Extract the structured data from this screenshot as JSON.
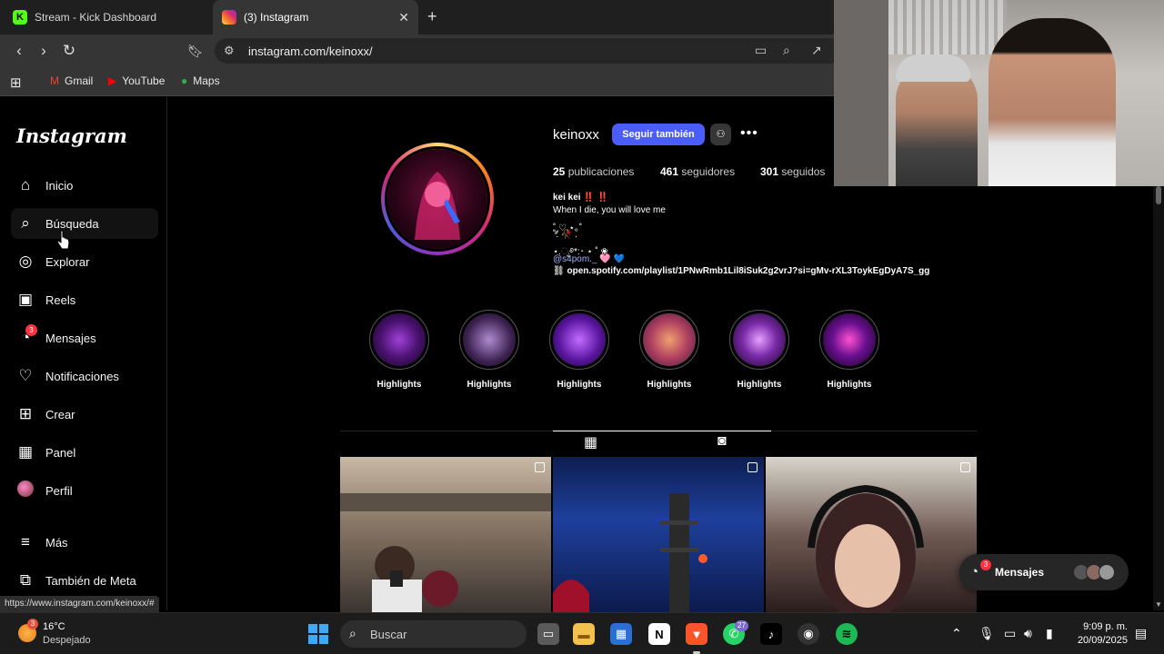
{
  "browser": {
    "tabs": [
      {
        "label": "Stream - Kick Dashboard",
        "favicon": "kick-icon"
      },
      {
        "label": "(3) Instagram",
        "favicon": "instagram-icon"
      }
    ],
    "url": "instagram.com/keinoxx/",
    "bookmarks": [
      "Gmail",
      "YouTube",
      "Maps"
    ],
    "status_url": "https://www.instagram.com/keinoxx/#"
  },
  "sidebar": {
    "logo": "Instagram",
    "items": [
      {
        "label": "Inicio",
        "icon": "home-icon"
      },
      {
        "label": "Búsqueda",
        "icon": "search-icon"
      },
      {
        "label": "Explorar",
        "icon": "compass-icon"
      },
      {
        "label": "Reels",
        "icon": "reels-icon"
      },
      {
        "label": "Mensajes",
        "icon": "messenger-icon",
        "badge": "3"
      },
      {
        "label": "Notificaciones",
        "icon": "heart-icon"
      },
      {
        "label": "Crear",
        "icon": "plus-square-icon"
      },
      {
        "label": "Panel",
        "icon": "chart-icon"
      },
      {
        "label": "Perfil",
        "icon": "avatar-icon"
      },
      {
        "label": "Más",
        "icon": "menu-icon"
      },
      {
        "label": "También de Meta",
        "icon": "meta-icon"
      }
    ]
  },
  "profile": {
    "username": "keinoxx",
    "follow_label": "Seguir también",
    "more_label": "•••",
    "posts_count": "25",
    "posts_label": "publicaciones",
    "followers_count": "461",
    "followers_label": "seguidores",
    "following_count": "301",
    "following_label": "seguidos",
    "bio": {
      "name": "kei kei ‼️ ‼️",
      "line1": "When I die, you will love me",
      "line2": "˚ ༘♡ ⋆｡˚",
      "line3": "˚. 🥀 .",
      "line4": "⋆.ೃ࿔*:･ ⋆ ˚ ❀",
      "mention": "@s4pom._ 🩷 💙",
      "link": "open.spotify.com/playlist/1PNwRmb1Lil8iSuk2g2vrJ?si=gMv-rXL3ToykEgDyA7S_gg"
    },
    "highlights": [
      "Highlights",
      "Highlights",
      "Highlights",
      "Highlights",
      "Highlights",
      "Highlights"
    ]
  },
  "messages_pill": {
    "label": "Mensajes",
    "badge": "3"
  },
  "taskbar": {
    "temp": "16°C",
    "condition": "Despejado",
    "weather_badge": "3",
    "search_label": "Buscar",
    "whatsapp_badge": "27",
    "time": "9:09 p. m.",
    "date": "20/09/2025"
  }
}
